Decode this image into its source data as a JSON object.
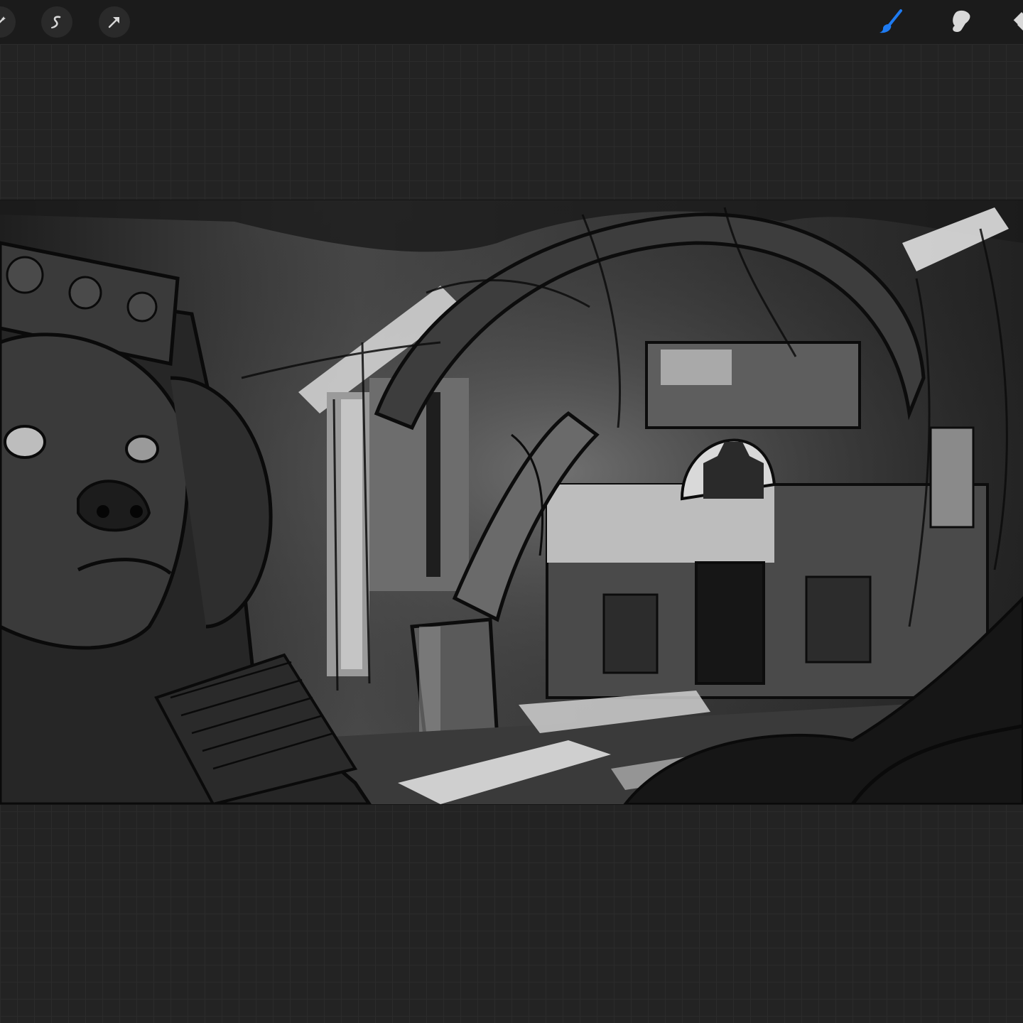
{
  "app": {
    "accent_color": "#1e7bf2",
    "icon_color": "#d8d8d8"
  },
  "toolbar": {
    "left_tools": [
      {
        "icon": "adjustments-wand-icon"
      },
      {
        "icon": "selection-icon"
      },
      {
        "icon": "transform-arrow-icon"
      }
    ],
    "right_tools": [
      {
        "icon": "brush-icon",
        "active": true
      },
      {
        "icon": "smudge-icon",
        "active": false
      },
      {
        "icon": "eraser-icon",
        "active": false
      }
    ]
  },
  "canvas": {
    "description_hidden": "",
    "palette": [
      "#0c0c0c",
      "#3a3a3a",
      "#6a6a6a",
      "#bdbdbd",
      "#e6e6e6"
    ]
  }
}
